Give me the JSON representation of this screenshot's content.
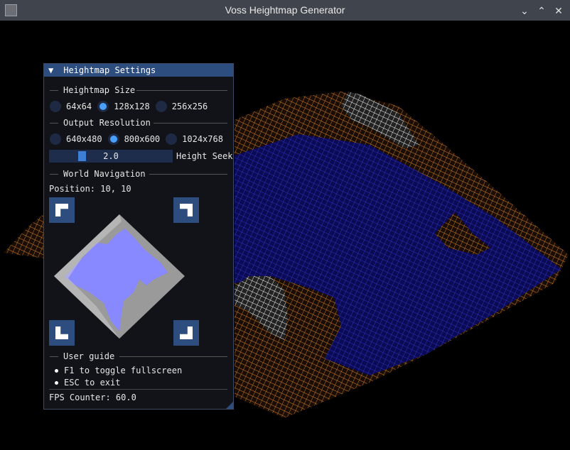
{
  "window": {
    "title": "Voss Heightmap Generator",
    "icon": "app-icon",
    "controls": [
      "minimize-icon",
      "maximize-icon",
      "close-icon"
    ]
  },
  "panel": {
    "title": "Heightmap Settings",
    "collapse_arrow": "▼",
    "heightmap_size": {
      "label": "Heightmap Size",
      "options": [
        "64x64",
        "128x128",
        "256x256"
      ],
      "selected": "128x128"
    },
    "output_resolution": {
      "label": "Output Resolution",
      "options": [
        "640x480",
        "800x600",
        "1024x768"
      ],
      "selected": "800x600"
    },
    "height_seek": {
      "label": "Height Seek",
      "value": "2.0"
    },
    "world_navigation": {
      "label": "World Navigation",
      "position": "Position: 10, 10"
    },
    "user_guide": {
      "label": "User guide",
      "items": [
        "F1 to toggle fullscreen",
        "ESC to exit"
      ]
    },
    "fps": "FPS Counter: 60.0"
  },
  "colors": {
    "panel_header": "#2d4d7f",
    "accent": "#4aa0ff",
    "water": "#1a1a8c",
    "land": "#c46a1a",
    "peak": "#ffffff",
    "minimap_water": "#8888ff"
  }
}
